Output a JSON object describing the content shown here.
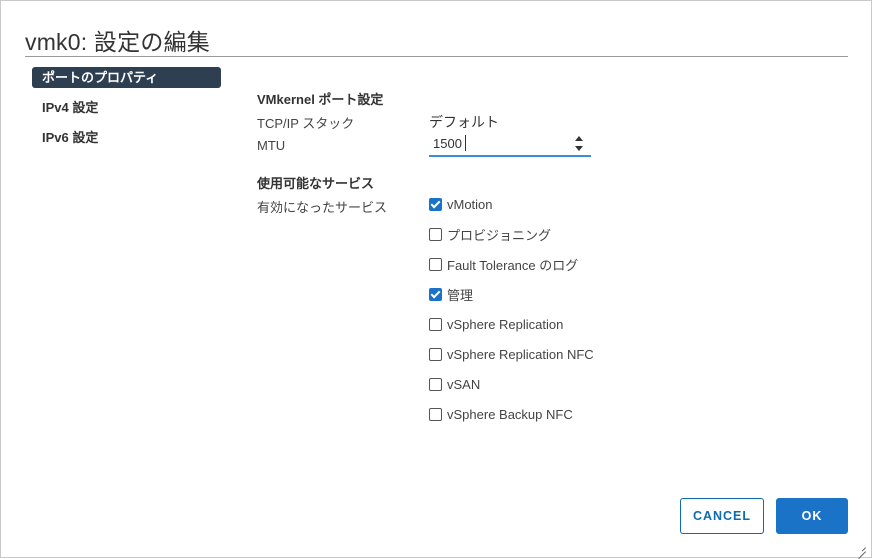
{
  "dialog": {
    "title": "vmk0: 設定の編集"
  },
  "nav": {
    "items": [
      {
        "label": "ポートのプロパティ",
        "active": true
      },
      {
        "label": "IPv4 設定",
        "active": false
      },
      {
        "label": "IPv6 設定",
        "active": false
      }
    ]
  },
  "port_settings": {
    "section_title": "VMkernel ポート設定",
    "tcpip_label": "TCP/IP スタック",
    "tcpip_value": "デフォルト",
    "mtu_label": "MTU",
    "mtu_value": "1500"
  },
  "services": {
    "section_title": "使用可能なサービス",
    "enabled_label": "有効になったサービス",
    "items": [
      {
        "label": "vMotion",
        "checked": true
      },
      {
        "label": "プロビジョニング",
        "checked": false
      },
      {
        "label": "Fault Tolerance のログ",
        "checked": false
      },
      {
        "label": "管理",
        "checked": true
      },
      {
        "label": "vSphere Replication",
        "checked": false
      },
      {
        "label": "vSphere Replication NFC",
        "checked": false
      },
      {
        "label": "vSAN",
        "checked": false
      },
      {
        "label": "vSphere Backup NFC",
        "checked": false
      }
    ]
  },
  "footer": {
    "cancel_label": "CANCEL",
    "ok_label": "OK"
  },
  "colors": {
    "accent": "#1a73c6",
    "nav_active": "#2e3f52"
  }
}
